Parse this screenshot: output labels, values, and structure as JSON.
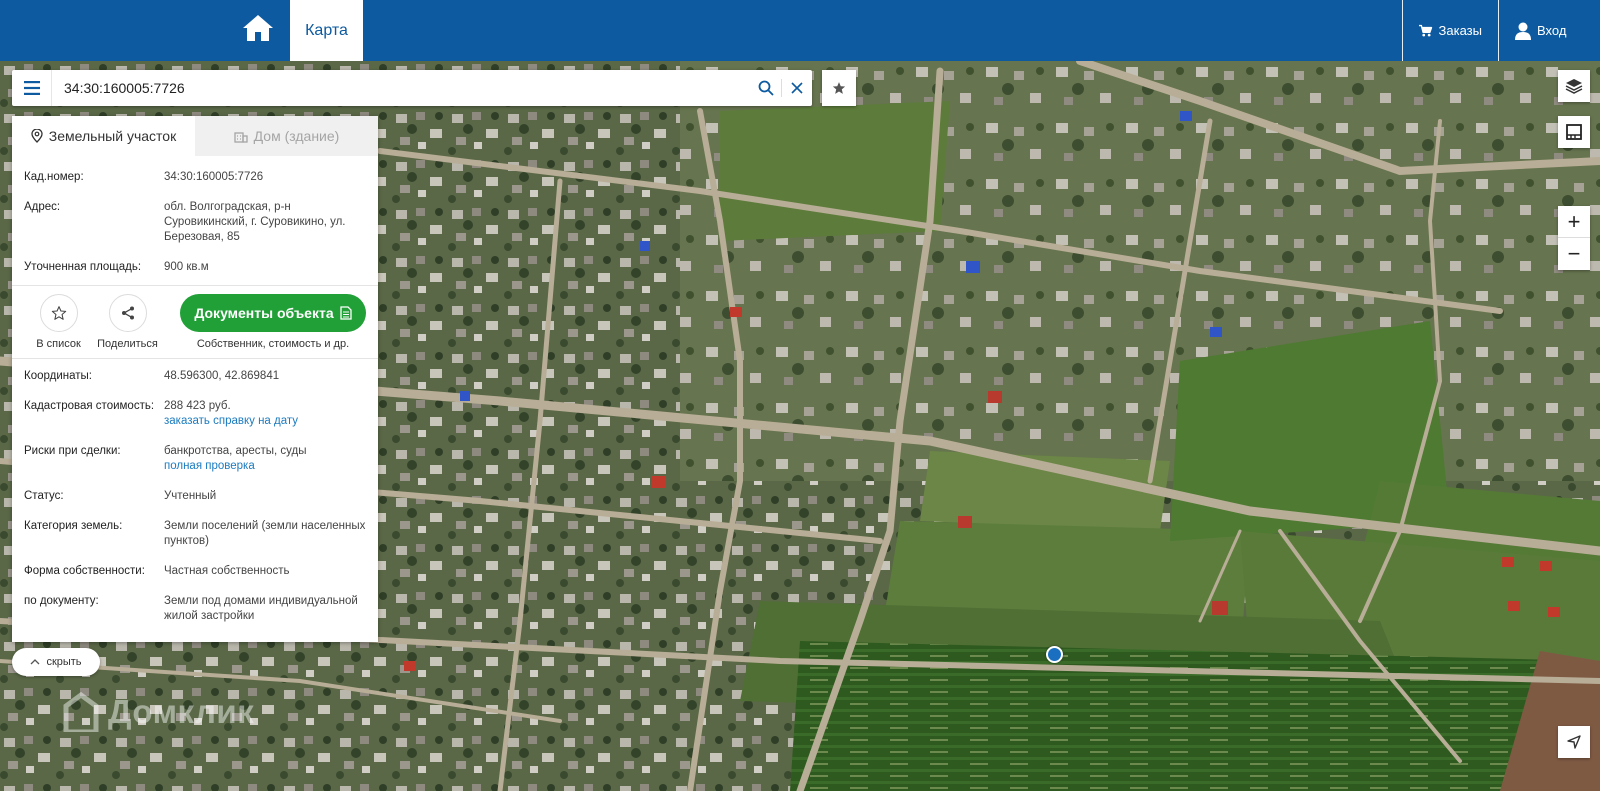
{
  "header": {
    "tab_map": "Карта",
    "orders_label": "Заказы",
    "login_label": "Вход"
  },
  "search": {
    "value": "34:30:160005:7726"
  },
  "panel": {
    "tab_land": "Земельный участок",
    "tab_house": "Дом (здание)",
    "cad_label": "Кад.номер:",
    "cad_value": "34:30:160005:7726",
    "address_label": "Адрес:",
    "address_value": "обл. Волгоградская, р-н Суровикинский, г. Суровикино, ул. Березовая, 85",
    "area_label": "Уточненная площадь:",
    "area_value": "900 кв.м",
    "action_list": "В список",
    "action_share": "Поделиться",
    "docs_button": "Документы объекта",
    "docs_caption": "Собственник, стоимость и др.",
    "coords_label": "Координаты:",
    "coords_value": "48.596300, 42.869841",
    "cost_label": "Кадастровая стоимость:",
    "cost_value": "288 423 руб.",
    "cost_link": "заказать справку на дату",
    "risks_label": "Риски при сделки:",
    "risks_value": "банкротства, аресты, суды",
    "risks_link": "полная проверка",
    "status_label": "Статус:",
    "status_value": "Учтенный",
    "category_label": "Категория земель:",
    "category_value": "Земли поселений (земли населенных пунктов)",
    "ownership_label": "Форма собственности:",
    "ownership_value": "Частная собственность",
    "doc_label": "по документу:",
    "doc_value": "Земли под домами индивидуальной жилой застройки"
  },
  "hide_label": "скрыть",
  "zoom": {
    "in": "+",
    "out": "−"
  },
  "watermark": "Домклик",
  "colors": {
    "header_bg": "#0d5aa0",
    "docs_button": "#21a038",
    "link": "#1b7bbf",
    "marker": "#1b6fc0"
  },
  "icons": [
    "home-icon",
    "cart-icon",
    "user-icon",
    "menu-icon",
    "search-icon",
    "close-icon",
    "star-icon",
    "layers-icon",
    "ruler-icon",
    "map-pin-icon",
    "building-icon",
    "share-icon",
    "document-icon",
    "chevron-up-icon",
    "navigation-arrow-icon"
  ]
}
